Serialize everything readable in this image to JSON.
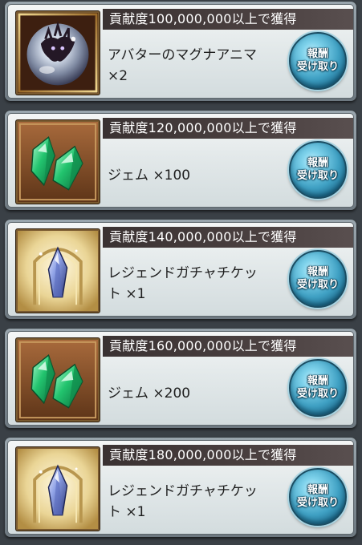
{
  "rewards": [
    {
      "condition": "貢献度100,000,000以上で獲得",
      "item_line1": "アバターのマグナアニマ",
      "item_line2": "×2",
      "icon": "magna-anima-icon",
      "button_line1": "報酬",
      "button_line2": "受け取り"
    },
    {
      "condition": "貢献度120,000,000以上で獲得",
      "item_line1": "ジェム ×100",
      "item_line2": "",
      "icon": "gem-icon",
      "button_line1": "報酬",
      "button_line2": "受け取り"
    },
    {
      "condition": "貢献度140,000,000以上で獲得",
      "item_line1": "レジェンドガチャチケッ",
      "item_line2": "ト ×1",
      "icon": "legend-ticket-icon",
      "button_line1": "報酬",
      "button_line2": "受け取り"
    },
    {
      "condition": "貢献度160,000,000以上で獲得",
      "item_line1": "ジェム ×200",
      "item_line2": "",
      "icon": "gem-icon",
      "button_line1": "報酬",
      "button_line2": "受け取り"
    },
    {
      "condition": "貢献度180,000,000以上で獲得",
      "item_line1": "レジェンドガチャチケッ",
      "item_line2": "ト ×1",
      "icon": "legend-ticket-icon",
      "button_line1": "報酬",
      "button_line2": "受け取り"
    }
  ],
  "colors": {
    "button_blue": "#3e9fc2",
    "header_bar": "#3a3232",
    "gem_green": "#1fbf6a"
  }
}
